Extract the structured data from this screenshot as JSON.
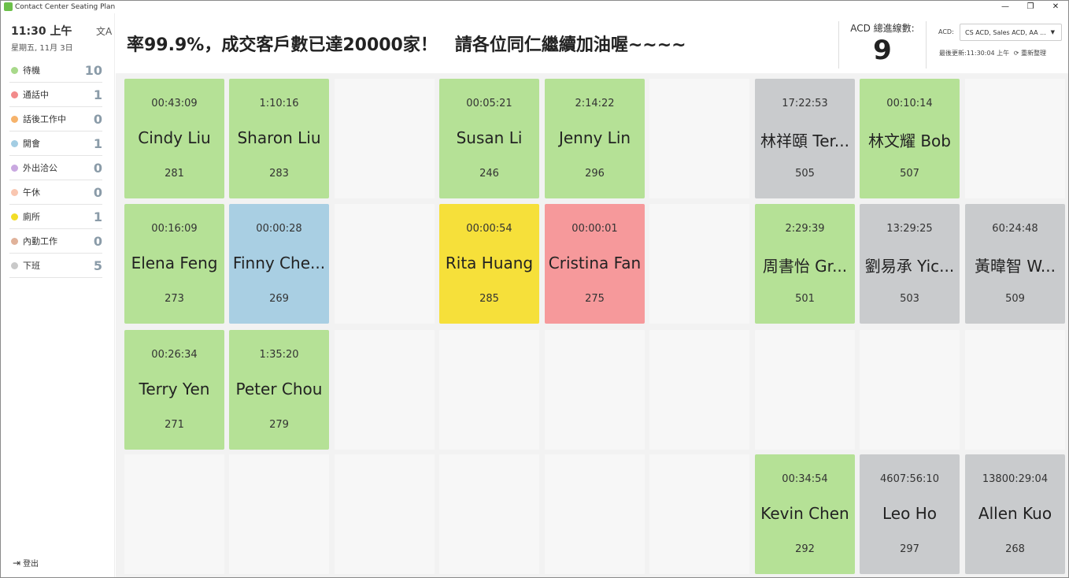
{
  "window": {
    "title": "Contact Center Seating Plan",
    "minimize": "—",
    "restore": "❐",
    "close": "✕"
  },
  "sidebar": {
    "time": "11:30 上午",
    "date": "星期五, 11月 3日",
    "translate_icon": "文A",
    "statuses": [
      {
        "label": "待機",
        "count": "10",
        "color": "#a8d98a"
      },
      {
        "label": "通話中",
        "count": "1",
        "color": "#f28b8b"
      },
      {
        "label": "話後工作中",
        "count": "0",
        "color": "#f6b36b"
      },
      {
        "label": "開會",
        "count": "1",
        "color": "#a3cde3"
      },
      {
        "label": "外出洽公",
        "count": "0",
        "color": "#c9a8e0"
      },
      {
        "label": "午休",
        "count": "0",
        "color": "#f9c6b0"
      },
      {
        "label": "廁所",
        "count": "1",
        "color": "#f2dd27"
      },
      {
        "label": "內勤工作",
        "count": "0",
        "color": "#e0b29a"
      },
      {
        "label": "下班",
        "count": "5",
        "color": "#c9c9c9"
      }
    ],
    "logout_label": "登出"
  },
  "header": {
    "marquee": "率99.9%，成交客戶數已達20000家！　請各位同仁繼續加油喔~~~~",
    "acd_total_label": "ACD 總進線數:",
    "acd_total": "9",
    "acd_select_label": "ACD:",
    "acd_select_value": "CS ACD, Sales ACD, AA ...",
    "updated": "最後更新:11:30:04 上午",
    "refresh_label": "重新整理"
  },
  "colors": {
    "idle": "#b5e196",
    "meeting": "#a9cfe3",
    "restroom": "#f6e03a",
    "on_call": "#f6999b",
    "off": "#c9cbcd"
  },
  "seats": [
    {
      "row": 0,
      "col": 0,
      "time": "00:43:09",
      "name": "Cindy Liu",
      "ext": "281",
      "status": "idle"
    },
    {
      "row": 0,
      "col": 1,
      "time": "1:10:16",
      "name": "Sharon Liu",
      "ext": "283",
      "status": "idle"
    },
    {
      "row": 0,
      "col": 3,
      "time": "00:05:21",
      "name": "Susan Li",
      "ext": "246",
      "status": "idle"
    },
    {
      "row": 0,
      "col": 4,
      "time": "2:14:22",
      "name": "Jenny Lin",
      "ext": "296",
      "status": "idle"
    },
    {
      "row": 0,
      "col": 6,
      "time": "17:22:53",
      "name": "林祥頤 Ter...",
      "ext": "505",
      "status": "off"
    },
    {
      "row": 0,
      "col": 7,
      "time": "00:10:14",
      "name": "林文耀 Bob",
      "ext": "507",
      "status": "idle"
    },
    {
      "row": 1,
      "col": 0,
      "time": "00:16:09",
      "name": "Elena Feng",
      "ext": "273",
      "status": "idle"
    },
    {
      "row": 1,
      "col": 1,
      "time": "00:00:28",
      "name": "Finny Che...",
      "ext": "269",
      "status": "meeting"
    },
    {
      "row": 1,
      "col": 3,
      "time": "00:00:54",
      "name": "Rita Huang",
      "ext": "285",
      "status": "restroom"
    },
    {
      "row": 1,
      "col": 4,
      "time": "00:00:01",
      "name": "Cristina Fan",
      "ext": "275",
      "status": "on_call"
    },
    {
      "row": 1,
      "col": 6,
      "time": "2:29:39",
      "name": "周書怡 Gr...",
      "ext": "501",
      "status": "idle"
    },
    {
      "row": 1,
      "col": 7,
      "time": "13:29:25",
      "name": "劉易承 Yic...",
      "ext": "503",
      "status": "off"
    },
    {
      "row": 1,
      "col": 8,
      "time": "60:24:48",
      "name": "黃暐智 W...",
      "ext": "509",
      "status": "off"
    },
    {
      "row": 2,
      "col": 0,
      "time": "00:26:34",
      "name": "Terry Yen",
      "ext": "271",
      "status": "idle"
    },
    {
      "row": 2,
      "col": 1,
      "time": "1:35:20",
      "name": "Peter Chou",
      "ext": "279",
      "status": "idle"
    },
    {
      "row": 3,
      "col": 6,
      "time": "00:34:54",
      "name": "Kevin Chen",
      "ext": "292",
      "status": "idle"
    },
    {
      "row": 3,
      "col": 7,
      "time": "4607:56:10",
      "name": "Leo Ho",
      "ext": "297",
      "status": "off"
    },
    {
      "row": 3,
      "col": 8,
      "time": "13800:29:04",
      "name": "Allen Kuo",
      "ext": "268",
      "status": "off"
    }
  ]
}
